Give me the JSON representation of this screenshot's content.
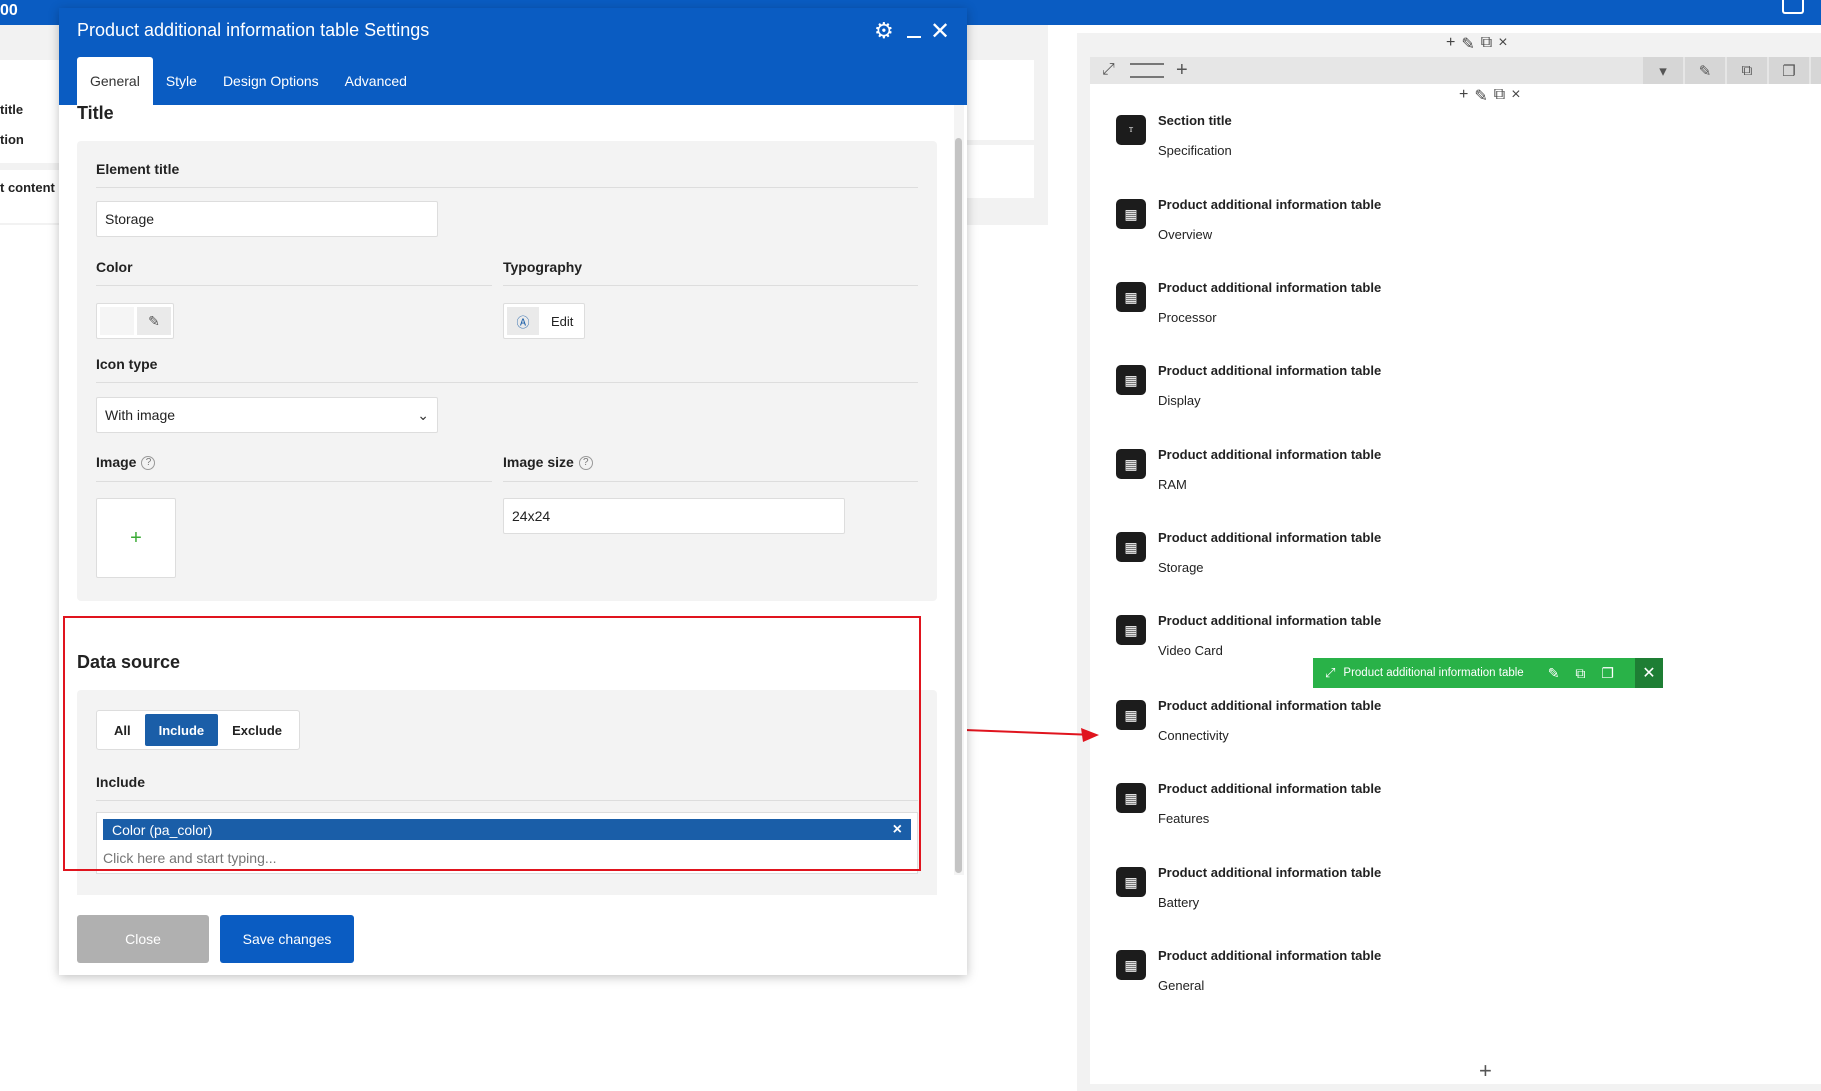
{
  "topbar": {
    "logo_text": "00",
    "monitor_icon": "monitor-icon"
  },
  "background": {
    "left_items": [
      "title",
      "tion",
      "t content"
    ]
  },
  "modal": {
    "title": "Product additional information table Settings",
    "tabs": [
      {
        "label": "General",
        "active": true
      },
      {
        "label": "Style",
        "active": false
      },
      {
        "label": "Design Options",
        "active": false
      },
      {
        "label": "Advanced",
        "active": false
      }
    ],
    "title_section": {
      "heading": "Title",
      "element_title_label": "Element title",
      "element_title_value": "Storage",
      "color_label": "Color",
      "typography_label": "Typography",
      "typography_edit": "Edit",
      "icon_type_label": "Icon type",
      "icon_type_value": "With image",
      "image_label": "Image",
      "image_help": "?",
      "image_add": "+",
      "image_size_label": "Image size",
      "image_size_help": "?",
      "image_size_value": "24x24"
    },
    "data_source": {
      "heading": "Data source",
      "options": [
        {
          "label": "All",
          "active": false
        },
        {
          "label": "Include",
          "active": true
        },
        {
          "label": "Exclude",
          "active": false
        }
      ],
      "include_label": "Include",
      "tag": "Color (pa_color)",
      "tag_remove": "×",
      "placeholder": "Click here and start typing..."
    },
    "buttons": {
      "close": "Close",
      "save": "Save changes"
    }
  },
  "builder": {
    "row_controls": [
      "+",
      "✎",
      "⧉",
      "×"
    ],
    "elements": [
      {
        "name": "Section title",
        "sub": "Specification",
        "icon": "title-icon"
      },
      {
        "name": "Product additional information table",
        "sub": "Overview",
        "icon": "table-icon"
      },
      {
        "name": "Product additional information table",
        "sub": "Processor",
        "icon": "table-icon"
      },
      {
        "name": "Product additional information table",
        "sub": "Display",
        "icon": "table-icon"
      },
      {
        "name": "Product additional information table",
        "sub": "RAM",
        "icon": "table-icon"
      },
      {
        "name": "Product additional information table",
        "sub": "Storage",
        "icon": "table-icon"
      },
      {
        "name": "Product additional information table",
        "sub": "Video Card",
        "icon": "table-icon"
      },
      {
        "name": "Product additional information table",
        "sub": "Connectivity",
        "icon": "table-icon"
      },
      {
        "name": "Product additional information table",
        "sub": "Features",
        "icon": "table-icon"
      },
      {
        "name": "Product additional information table",
        "sub": "Battery",
        "icon": "table-icon"
      },
      {
        "name": "Product additional information table",
        "sub": "General",
        "icon": "table-icon"
      }
    ],
    "hover_bar": {
      "label": "Product additional information table"
    },
    "add_element": "+"
  },
  "colors": {
    "primary_blue": "#0a5cc2",
    "tag_blue": "#1a5ea8",
    "highlight_red": "#e0141e",
    "hover_green": "#29b248"
  }
}
